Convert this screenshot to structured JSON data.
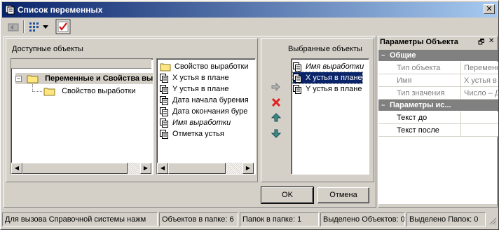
{
  "window": {
    "title": "Список переменных",
    "close_glyph": "✕"
  },
  "left_panel": {
    "title": "Доступные объекты",
    "tree": {
      "root_label": "Переменные и Свойства вы",
      "child_label": "Свойство выработки"
    },
    "list": [
      {
        "label": "Свойство выработки",
        "icon": "folder-icon",
        "italic": false
      },
      {
        "label": "X устья в плане",
        "icon": "variable-icon",
        "italic": false
      },
      {
        "label": "Y устья в плане",
        "icon": "variable-icon",
        "italic": false
      },
      {
        "label": "Дата начала бурения",
        "icon": "variable-icon",
        "italic": false
      },
      {
        "label": "Дата окончания буре",
        "icon": "variable-icon",
        "italic": false
      },
      {
        "label": "Имя выработки",
        "icon": "variable-icon",
        "italic": true
      },
      {
        "label": "Отметка устья",
        "icon": "variable-icon",
        "italic": false
      }
    ]
  },
  "right_panel": {
    "title": "Выбранные объекты",
    "list": [
      {
        "label": "Имя выработки",
        "italic": true,
        "selected": false
      },
      {
        "label": "X устья в плане",
        "italic": false,
        "selected": true
      },
      {
        "label": "Y устья в плане",
        "italic": false,
        "selected": false
      }
    ]
  },
  "buttons": {
    "ok": "OK",
    "cancel": "Отмена"
  },
  "properties": {
    "title": "Параметры Объекта",
    "pin_glyph": "🗗",
    "close_glyph": "✕",
    "groups": [
      {
        "name": "Общие",
        "rows": [
          {
            "key": "Тип объекта",
            "value": "Переменн"
          },
          {
            "key": "Имя",
            "value": "X устья в"
          },
          {
            "key": "Тип значения",
            "value": "Число – Д"
          }
        ]
      },
      {
        "name": "Параметры ис...",
        "rows": [
          {
            "key": "Текст до",
            "value": ""
          },
          {
            "key": "Текст после",
            "value": ""
          }
        ]
      }
    ]
  },
  "status": {
    "help": "Для вызова Справочной системы нажм",
    "objects_in_folder": "Объектов в папке: 6",
    "folders_in_folder": "Папок в папке: 1",
    "selected_objects": "Выделено Объектов: 0",
    "selected_folders": "Выделено Папок: 0"
  },
  "colors": {
    "titlebar": "#0a246a",
    "selection": "#0a246a",
    "delete": "#e02020",
    "move": "#3a8a8a"
  }
}
